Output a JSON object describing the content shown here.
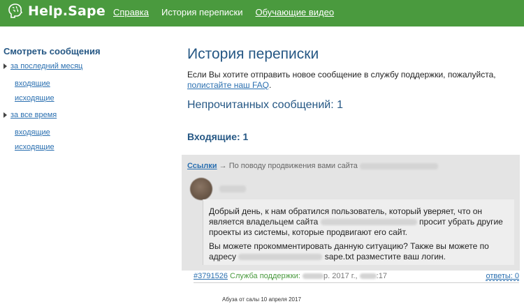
{
  "header": {
    "logo_text": "Help.Sape",
    "nav": [
      {
        "label": "Справка",
        "active": false
      },
      {
        "label": "История переписки",
        "active": true
      },
      {
        "label": "Обучающие видео",
        "active": false
      }
    ],
    "brand_color": "#4a9a3e"
  },
  "sidebar": {
    "title": "Смотреть сообщения",
    "groups": [
      {
        "label": "за последний месяц",
        "items": [
          "входящие",
          "исходящие"
        ]
      },
      {
        "label": "за все время",
        "items": [
          "входящие",
          "исходящие"
        ]
      }
    ]
  },
  "main": {
    "title": "История переписки",
    "intro_text": "Если Вы хотите отправить новое сообщение в службу поддержки, пожалуйста,",
    "intro_link": "полистайте наш FAQ",
    "intro_end": ".",
    "unread": "Непрочитанных сообщений: 1",
    "inbox_heading": "Входящие: 1"
  },
  "message": {
    "category": "Ссылки",
    "arrow": "→",
    "subject": "По поводу продвижения вами сайта",
    "body_p1_a": "Добрый день, к нам обратился пользователь, который уверяет, что он является владельцем сайта",
    "body_p1_b": "просит убрать другие проекты из системы, которые продвигают его сайт.",
    "body_p2_a": "Вы можете прокомментировать данную ситуацию? Также вы можете по адресу",
    "body_p2_b": "sape.txt разместите ваш логин.",
    "ticket_number": "#3791526",
    "support_label": "Служба поддержки:",
    "date_visible": "р. 2017 г.,",
    "time_visible": ":17",
    "replies": "ответы: 0"
  },
  "footer": {
    "caption": "Абуза от салы 10 апреля 2017"
  }
}
